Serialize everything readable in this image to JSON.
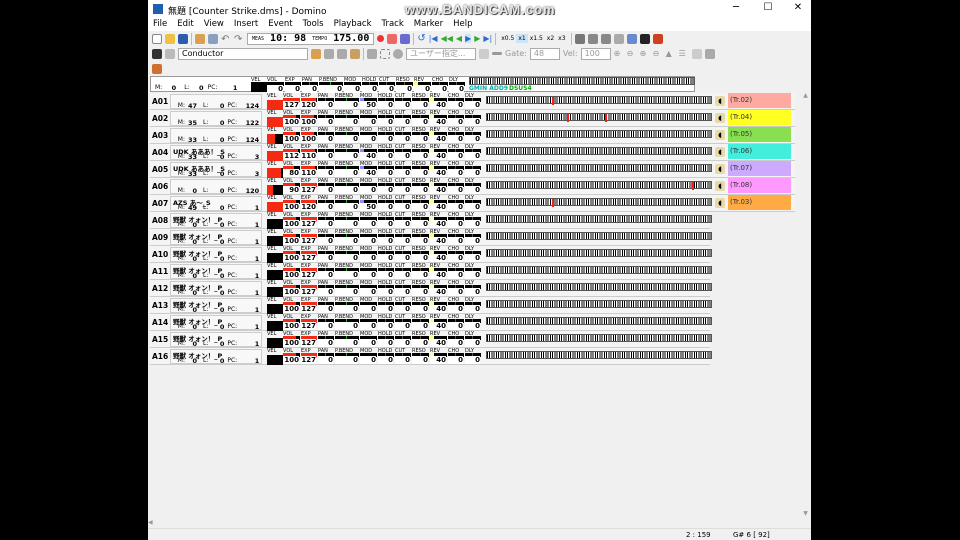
{
  "watermark": "www.BANDICAM.com",
  "window": {
    "title": "無題 [Counter Strike.dms] - Domino",
    "min": "─",
    "max": "☐",
    "close": "✕"
  },
  "menu": [
    "File",
    "Edit",
    "View",
    "Insert",
    "Event",
    "Tools",
    "Playback",
    "Track",
    "Marker",
    "Help"
  ],
  "toolbar": {
    "meas_label": "MEAS",
    "meas": "10:",
    "tick": "98",
    "tempo_label": "TEMPO",
    "tempo": "175.00",
    "speeds": [
      "x0.5",
      "x1",
      "x1.5",
      "x2",
      "x3"
    ],
    "active_speed": "x1"
  },
  "toolbar2": {
    "track": "Conductor",
    "user_combo": "ユーザー指定...",
    "gate_label": "Gate:",
    "gate": "48",
    "vel_label": "Vel:",
    "vel": "100"
  },
  "conductor": {
    "m": "0",
    "l": "0",
    "pc": "1",
    "vel_label": "VEL",
    "chord1": "GMIN ADD9",
    "chord2": "DSUS4",
    "values": [
      "0",
      "0",
      "0",
      "0",
      "0",
      "0",
      "0",
      "0",
      "0",
      "0",
      "0"
    ]
  },
  "control_labels": [
    "VOL",
    "EXP",
    "PAN",
    "P.BEND",
    "MOD",
    "HOLD",
    "CUT",
    "RESO",
    "REV",
    "CHO",
    "DLY"
  ],
  "field_labels": {
    "m": "M:",
    "l": "L:",
    "pc": "PC:",
    "vel": "VEL"
  },
  "tracks": [
    {
      "id": "A01",
      "name": "",
      "m": "47",
      "l": "0",
      "pc": "124",
      "vel": 1.0,
      "values": [
        "127",
        "120",
        "0",
        "0",
        "50",
        "0",
        "0",
        "0",
        "40",
        "0",
        "0"
      ],
      "tag": "(Tr.02)",
      "color": "#ffaaa0"
    },
    {
      "id": "A02",
      "name": "",
      "m": "35",
      "l": "0",
      "pc": "122",
      "vel": 1.0,
      "values": [
        "100",
        "100",
        "0",
        "0",
        "0",
        "0",
        "0",
        "0",
        "40",
        "0",
        "0"
      ],
      "tag": "(Tr.04)",
      "color": "#ffff22"
    },
    {
      "id": "A03",
      "name": "",
      "m": "33",
      "l": "0",
      "pc": "124",
      "vel": 0.5,
      "values": [
        "100",
        "100",
        "0",
        "0",
        "0",
        "0",
        "0",
        "0",
        "40",
        "0",
        "0"
      ],
      "tag": "(Tr.05)",
      "color": "#88e050"
    },
    {
      "id": "A04",
      "name": "UDK あああ！_S",
      "m": "33",
      "l": "0",
      "pc": "3",
      "vel": 1.0,
      "values": [
        "112",
        "110",
        "0",
        "0",
        "40",
        "0",
        "0",
        "0",
        "40",
        "0",
        "0"
      ],
      "tag": "(Tr.06)",
      "color": "#44eedd"
    },
    {
      "id": "A05",
      "name": "UDK あああ！_S",
      "m": "33",
      "l": "0",
      "pc": "3",
      "vel": 0.85,
      "values": [
        "80",
        "110",
        "0",
        "0",
        "40",
        "0",
        "0",
        "0",
        "40",
        "0",
        "0"
      ],
      "tag": "(Tr.07)",
      "color": "#ccaaff"
    },
    {
      "id": "A06",
      "name": "",
      "m": "0",
      "l": "0",
      "pc": "120",
      "vel": 0.4,
      "values": [
        "90",
        "127",
        "0",
        "0",
        "0",
        "0",
        "0",
        "0",
        "40",
        "0",
        "0"
      ],
      "tag": "(Tr.08)",
      "color": "#ff99ff"
    },
    {
      "id": "A07",
      "name": "AZS あ～_S",
      "m": "49",
      "l": "0",
      "pc": "1",
      "vel": 1.0,
      "values": [
        "100",
        "120",
        "0",
        "0",
        "50",
        "0",
        "0",
        "0",
        "40",
        "0",
        "0"
      ],
      "tag": "(Tr.03)",
      "color": "#ffaa44"
    },
    {
      "id": "A08",
      "name": "野獣 オォン！_P",
      "m": "0",
      "l": "0",
      "pc": "1",
      "vel": 0,
      "values": [
        "100",
        "127",
        "0",
        "0",
        "0",
        "0",
        "0",
        "0",
        "40",
        "0",
        "0"
      ]
    },
    {
      "id": "A09",
      "name": "野獣 オォン！_P",
      "m": "0",
      "l": "0",
      "pc": "1",
      "vel": 0,
      "values": [
        "100",
        "127",
        "0",
        "0",
        "0",
        "0",
        "0",
        "0",
        "40",
        "0",
        "0"
      ]
    },
    {
      "id": "A10",
      "name": "野獣 オォン！_P",
      "m": "0",
      "l": "0",
      "pc": "1",
      "vel": 0,
      "values": [
        "100",
        "127",
        "0",
        "0",
        "0",
        "0",
        "0",
        "0",
        "40",
        "0",
        "0"
      ]
    },
    {
      "id": "A11",
      "name": "野獣 オォン！_P",
      "m": "0",
      "l": "0",
      "pc": "1",
      "vel": 0,
      "values": [
        "100",
        "127",
        "0",
        "0",
        "0",
        "0",
        "0",
        "0",
        "40",
        "0",
        "0"
      ]
    },
    {
      "id": "A12",
      "name": "野獣 オォン！_P",
      "m": "0",
      "l": "0",
      "pc": "1",
      "vel": 0,
      "values": [
        "100",
        "127",
        "0",
        "0",
        "0",
        "0",
        "0",
        "0",
        "40",
        "0",
        "0"
      ]
    },
    {
      "id": "A13",
      "name": "野獣 オォン！_P",
      "m": "0",
      "l": "0",
      "pc": "1",
      "vel": 0,
      "values": [
        "100",
        "127",
        "0",
        "0",
        "0",
        "0",
        "0",
        "0",
        "40",
        "0",
        "0"
      ]
    },
    {
      "id": "A14",
      "name": "野獣 オォン！_P",
      "m": "0",
      "l": "0",
      "pc": "1",
      "vel": 0,
      "values": [
        "100",
        "127",
        "0",
        "0",
        "0",
        "0",
        "0",
        "0",
        "40",
        "0",
        "0"
      ]
    },
    {
      "id": "A15",
      "name": "野獣 オォン！_P",
      "m": "0",
      "l": "0",
      "pc": "1",
      "vel": 0,
      "values": [
        "100",
        "127",
        "0",
        "0",
        "0",
        "0",
        "0",
        "0",
        "40",
        "0",
        "0"
      ]
    },
    {
      "id": "A16",
      "name": "野獣 オォン！_P",
      "m": "0",
      "l": "0",
      "pc": "1",
      "vel": 0,
      "values": [
        "100",
        "127",
        "0",
        "0",
        "0",
        "0",
        "0",
        "0",
        "40",
        "0",
        "0"
      ]
    }
  ],
  "status": {
    "position": "2 : 159",
    "note": "G# 6 [ 92]"
  }
}
